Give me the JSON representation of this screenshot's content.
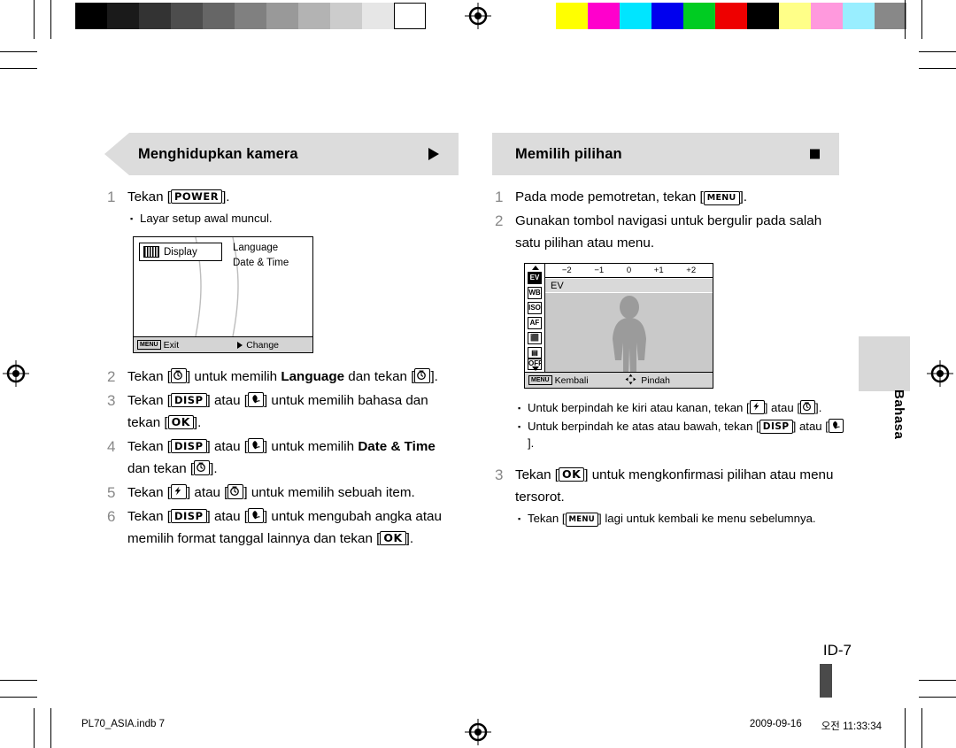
{
  "document": {
    "page_number": "ID-7",
    "side_tab_label": "Bahasa",
    "footer_file": "PL70_ASIA.indb   7",
    "footer_date": "2009-09-16",
    "footer_time": "오전 11:33:34"
  },
  "left_section": {
    "title": "Menghidupkan kamera",
    "steps": [
      {
        "num": "1",
        "text_before": "Tekan [",
        "key": "POWER",
        "text_after": "]."
      },
      {
        "num": "2",
        "text": "Tekan [timer] untuk memilih Language dan tekan [timer]."
      },
      {
        "num": "3",
        "text": "Tekan [DISP] atau [macro] untuk memilih bahasa dan tekan [OK]."
      },
      {
        "num": "4",
        "text": "Tekan [DISP] atau [macro] untuk memilih Date & Time dan tekan [timer]."
      },
      {
        "num": "5",
        "text": "Tekan [flash] atau [timer] untuk memilih sebuah item."
      },
      {
        "num": "6",
        "text": "Tekan [DISP] atau [macro] untuk mengubah angka atau memilih format tanggal lainnya dan tekan [OK]."
      }
    ],
    "step1_bullet": "Layar setup awal muncul.",
    "step2_parts": {
      "a": "Tekan [",
      "b": "] untuk memilih ",
      "bold": "Language",
      "c": " dan tekan [",
      "d": "]."
    },
    "step3_parts": {
      "a": "Tekan [",
      "b": "] atau [",
      "c": "] untuk memilih bahasa dan tekan [",
      "d": "]."
    },
    "step4_parts": {
      "a": "Tekan [",
      "b": "] atau [",
      "c": "] untuk memilih ",
      "bold": "Date & Time",
      "d": " dan tekan [",
      "e": "]."
    },
    "step5_parts": {
      "a": "Tekan [",
      "b": "] atau [",
      "c": "] untuk memilih sebuah item."
    },
    "step6_parts": {
      "a": "Tekan [",
      "b": "] atau [",
      "c": "] untuk mengubah angka atau memilih format tanggal lainnya dan tekan [",
      "d": "]."
    },
    "lcd": {
      "tab_label": "Display",
      "menu_items": [
        "Language",
        "Date & Time"
      ],
      "footer_menu_key": "MENU",
      "footer_exit": "Exit",
      "footer_change": "Change"
    }
  },
  "right_section": {
    "title": "Memilih pilihan",
    "step1": {
      "num": "1",
      "a": "Pada mode pemotretan, tekan [",
      "key": "MENU",
      "b": "]."
    },
    "step2": {
      "num": "2",
      "text": "Gunakan tombol navigasi untuk bergulir pada salah satu pilihan atau menu."
    },
    "step3": {
      "num": "3",
      "a": "Tekan [",
      "key": "OK",
      "b": "] untuk mengkonfirmasi pilihan atau menu tersorot."
    },
    "bullets": [
      {
        "a": "Untuk berpindah ke kiri atau kanan, tekan [",
        "b": "] atau [",
        "c": "]."
      },
      {
        "a": "Untuk berpindah ke atas atau bawah, tekan [",
        "key": "DISP",
        "b": "] atau [",
        "c": "]."
      }
    ],
    "step3_bullet": {
      "a": "Tekan [",
      "key": "MENU",
      "b": "] lagi untuk kembali ke menu sebelumnya."
    },
    "lcd": {
      "ev_ticks": [
        "−2",
        "−1",
        "0",
        "+1",
        "+2"
      ],
      "row_label": "EV",
      "sidebar_icons": [
        "EV",
        "WB",
        "ISO",
        "AF",
        "face",
        "meter",
        "OFF"
      ],
      "footer_menu_key": "MENU",
      "footer_back": "Kembali",
      "footer_move": "Pindah"
    }
  },
  "print_marks": {
    "gray_swatches": [
      "#000000",
      "#1a1a1a",
      "#333333",
      "#4d4d4d",
      "#666666",
      "#808080",
      "#999999",
      "#b3b3b3",
      "#cccccc",
      "#e6e6e6",
      "#ffffff"
    ],
    "color_swatches": [
      "#ffff00",
      "#ff00cc",
      "#00e5ff",
      "#0000ee",
      "#00cc22",
      "#ee0000",
      "#000000",
      "#ffff88",
      "#ff99dd",
      "#99eeff",
      "#888888"
    ]
  }
}
